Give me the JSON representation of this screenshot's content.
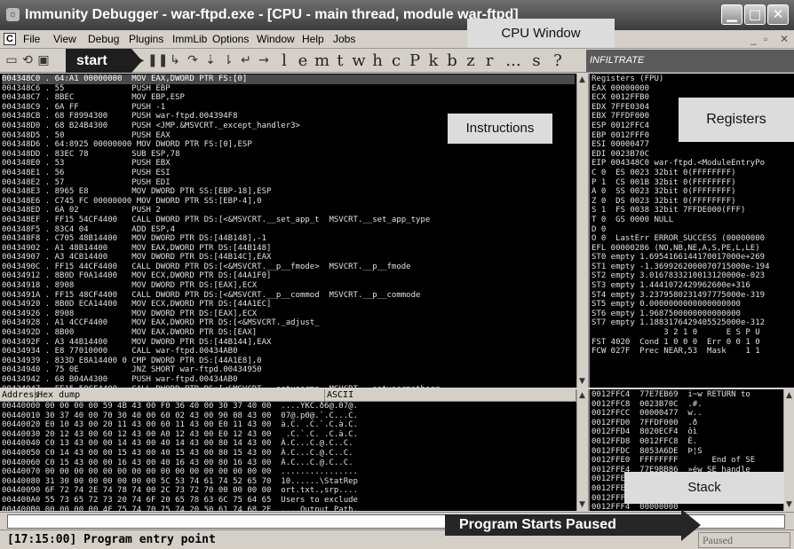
{
  "window": {
    "title": "Immunity Debugger - war-ftpd.exe - [CPU - main thread, module war-ftpd]",
    "app_icon": "bug-icon",
    "controls": [
      "minimize",
      "maximize",
      "close"
    ]
  },
  "menu": [
    "File",
    "View",
    "Debug",
    "Plugins",
    "ImmLib",
    "Options",
    "Window",
    "Help",
    "Jobs"
  ],
  "toolbar": {
    "letters": [
      "l",
      "e",
      "m",
      "t",
      "w",
      "h",
      "c",
      "P",
      "k",
      "b",
      "z",
      "r",
      "...",
      "s",
      "?"
    ],
    "infiltrate": "INFILTRATE"
  },
  "annotations": {
    "cpu_window": "CPU Window",
    "start": "start",
    "instructions": "Instructions",
    "registers": "Registers",
    "stack": "Stack",
    "program_paused": "Program Starts Paused"
  },
  "disasm": [
    "004348C0 . 64:A1 00000000  MOV EAX,DWORD PTR FS:[0]",
    "004348C6 . 55              PUSH EBP",
    "004348C7 . 8BEC            MOV EBP,ESP",
    "004348C9 . 6A FF           PUSH -1",
    "004348CB . 68 F8994300     PUSH war-ftpd.004394F8",
    "004348D0 . 68 B24B4300     PUSH <JMP.&MSVCRT._except_handler3>",
    "004348D5 . 50              PUSH EAX",
    "004348D6 . 64:8925 00000000 MOV DWORD PTR FS:[0],ESP",
    "004348DD . 83EC 78         SUB ESP,78",
    "004348E0 . 53              PUSH EBX",
    "004348E1 . 56              PUSH ESI",
    "004348E2 . 57              PUSH EDI",
    "004348E3 . 8965 E8         MOV DWORD PTR SS:[EBP-18],ESP",
    "004348E6 . C745 FC 00000000 MOV DWORD PTR SS:[EBP-4],0",
    "004348ED . 6A 02           PUSH 2",
    "004348EF . FF15 54CF4400   CALL DWORD PTR DS:[<&MSVCRT.__set_app_t  MSVCRT.__set_app_type",
    "004348F5 . 83C4 04         ADD ESP,4",
    "004348F8 . C705 48B14400   MOV DWORD PTR DS:[44B148],-1",
    "00434902 . A1 48B14400     MOV EAX,DWORD PTR DS:[44B148]",
    "00434907 . A3 4CB14400     MOV DWORD PTR DS:[44B14C],EAX",
    "0043490C . FF15 44CF4400   CALL DWORD PTR DS:[<&MSVCRT.__p__fmode>  MSVCRT.__p__fmode",
    "00434912 . 8B0D F0A14400   MOV ECX,DWORD PTR DS:[44A1F0]",
    "00434918 . 8908            MOV DWORD PTR DS:[EAX],ECX",
    "0043491A . FF15 48CF4400   CALL DWORD PTR DS:[<&MSVCRT.__p__commod  MSVCRT.__p__commode",
    "00434920 . 8B0D ECA14400   MOV ECX,DWORD PTR DS:[44A1EC]",
    "00434926 . 8908            MOV DWORD PTR DS:[EAX],ECX",
    "00434928 . A1 4CCF4400     MOV EAX,DWORD PTR DS:[<&MSVCRT._adjust_",
    "0043492D . 8B00            MOV EAX,DWORD PTR DS:[EAX]",
    "0043492F . A3 44B14400     MOV DWORD PTR DS:[44B144],EAX",
    "00434934 . E8 77010000     CALL war-ftpd.00434AB0",
    "00434939 . 833D E8A14400 0 CMP DWORD PTR DS:[44A1E8],0",
    "00434940 . 75 0E           JNZ SHORT war-ftpd.00434950",
    "00434942 . 68 B04A4300     PUSH war-ftpd.00434AB0",
    "00434947 . FF15 50CF4400   CALL DWORD PTR DS:[<&MSVCRT.__setuserma  MSVCRT.__setusermatherr",
    "0043494D . 83C4 04         ADD ESP,4",
    "00434950 > E8 2B010000     CALL war-ftpd.00434A80",
    "00434955 . 68 74004400     PUSH war-ftpd.00440074",
    "0043495A . 68 70004400     PUSH war-ftpd.00440070"
  ],
  "registers": [
    "Registers (FPU)",
    "EAX 00000000",
    "ECX 0012FFB0",
    "EDX 7FFE0304",
    "EBX 7FFDF000",
    "ESP 0012FFC4",
    "EBP 0012FFF0",
    "ESI 00000477",
    "EDI 0023B70C",
    "",
    "EIP 004348C0 war-ftpd.<ModuleEntryPo",
    "",
    "C 0  ES 0023 32bit 0(FFFFFFFF)",
    "P 1  CS 001B 32bit 0(FFFFFFFF)",
    "A 0  SS 0023 32bit 0(FFFFFFFF)",
    "Z 0  DS 0023 32bit 0(FFFFFFFF)",
    "S 1  FS 0038 32bit 7FFDE000(FFF)",
    "T 0  GS 0000 NULL",
    "D 0",
    "O 0  LastErr ERROR_SUCCESS (00000000",
    "",
    "EFL 00000286 (NO,NB,NE,A,S,PE,L,LE)",
    "",
    "ST0 empty 1.6954166144170017000e+269",
    "ST1 empty -1.3699262000070715000e-194",
    "ST2 empty 3.0167833210013120000e-023",
    "ST3 empty 1.4441072429962600e+316",
    "ST4 empty 3.2379580231497775000e-319",
    "ST5 empty 0.0000000000000000000",
    "ST6 empty 1.9687500000000000000",
    "ST7 empty 1.1883176429405525000e-312",
    "               3 2 1 0      E S P U",
    "FST 4020  Cond 1 0 0 0  Err 0 0 1 0",
    "FCW 027F  Prec NEAR,53  Mask    1 1"
  ],
  "dump": {
    "headers": [
      "Address",
      "Hex dump",
      "ASCII"
    ],
    "rows": [
      "00440000 00 00 00 00 59 4B 43 00 F0 36 40 00 30 37 40 00  ....YKC.ð6@.07@.",
      "00440010 30 37 40 00 70 30 40 00 60 02 43 00 90 08 43 00  07@.p0@.`.C...C.",
      "00440020 E0 10 43 00 20 11 43 00 60 11 43 00 E0 11 43 00  à.C. .C.`.C.à.C.",
      "00440030 20 12 43 00 60 12 43 00 A0 12 43 00 E0 12 43 00   .C.`.C. .C.à.C.",
      "00440040 C0 13 43 00 00 14 43 00 40 14 43 00 80 14 43 00  À.C...C.@.C..C.",
      "00440050 C0 14 43 00 00 15 43 00 40 15 43 00 80 15 43 00  À.C...C.@.C..C.",
      "00440060 C0 15 43 00 00 16 43 00 40 16 43 00 80 16 43 00  À.C...C.@.C..C.",
      "00440070 00 00 00 00 00 00 00 00 00 00 00 00 00 00 00 00  ................",
      "00440080 31 30 00 00 00 00 00 00 5C 53 74 61 74 52 65 70  10......\\StatRep",
      "00440090 6F 72 74 2E 74 78 74 00 2C 73 72 70 00 00 00 00  ort.txt.,srp....",
      "004400A0 55 73 65 72 73 20 74 6F 20 65 78 63 6C 75 64 65  Users to exclude",
      "004400B0 00 00 00 00 4F 75 74 70 75 74 20 50 61 74 68 2E  ....Output Path."
    ]
  },
  "stack": [
    "0012FFC4  77E7EB69  i~w RETURN to",
    "0012FFC8  0023B70C  .#.",
    "0012FFCC  00000477  w..",
    "0012FFD0  7FFDF000  .ð",
    "0012FFD4  8020ECF4  ôì ",
    "0012FFD8  0012FFC8  È.",
    "0012FFDC  8053A6DE  Þ¦S",
    "0012FFE0  FFFFFFFF       End of SE",
    "0012FFE4  77E9BB86  »éw SE handle",
    "0012FFE8  77E8F0B8",
    "0012FFEC  00000000",
    "0012FFF0  00000000",
    "0012FFF4  00000000"
  ],
  "status": {
    "message": "[17:15:00] Program entry point",
    "state": "Paused"
  }
}
